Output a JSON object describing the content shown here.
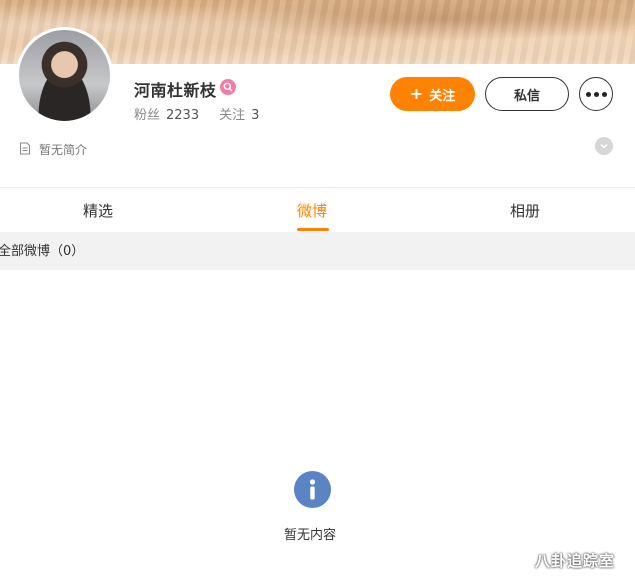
{
  "profile": {
    "name": "河南杜新枝",
    "fans_label": "粉丝",
    "fans_count": "2233",
    "following_label": "关注",
    "following_count": "3",
    "bio": "暂无简介"
  },
  "actions": {
    "follow_label": "关注",
    "message_label": "私信"
  },
  "tabs": [
    {
      "label": "精选",
      "active": false
    },
    {
      "label": "微博",
      "active": true
    },
    {
      "label": "相册",
      "active": false
    }
  ],
  "filter": {
    "label": "全部微博（0）"
  },
  "empty_state": {
    "text": "暂无内容"
  },
  "watermark": "八卦追踪室",
  "colors": {
    "accent": "#ff8200",
    "badge": "#f27ba8",
    "info_icon": "#5b84c4"
  },
  "icons": {
    "badge": "vip-badge-icon",
    "bio": "document-icon",
    "expand": "chevron-down-icon",
    "empty": "info-icon"
  }
}
